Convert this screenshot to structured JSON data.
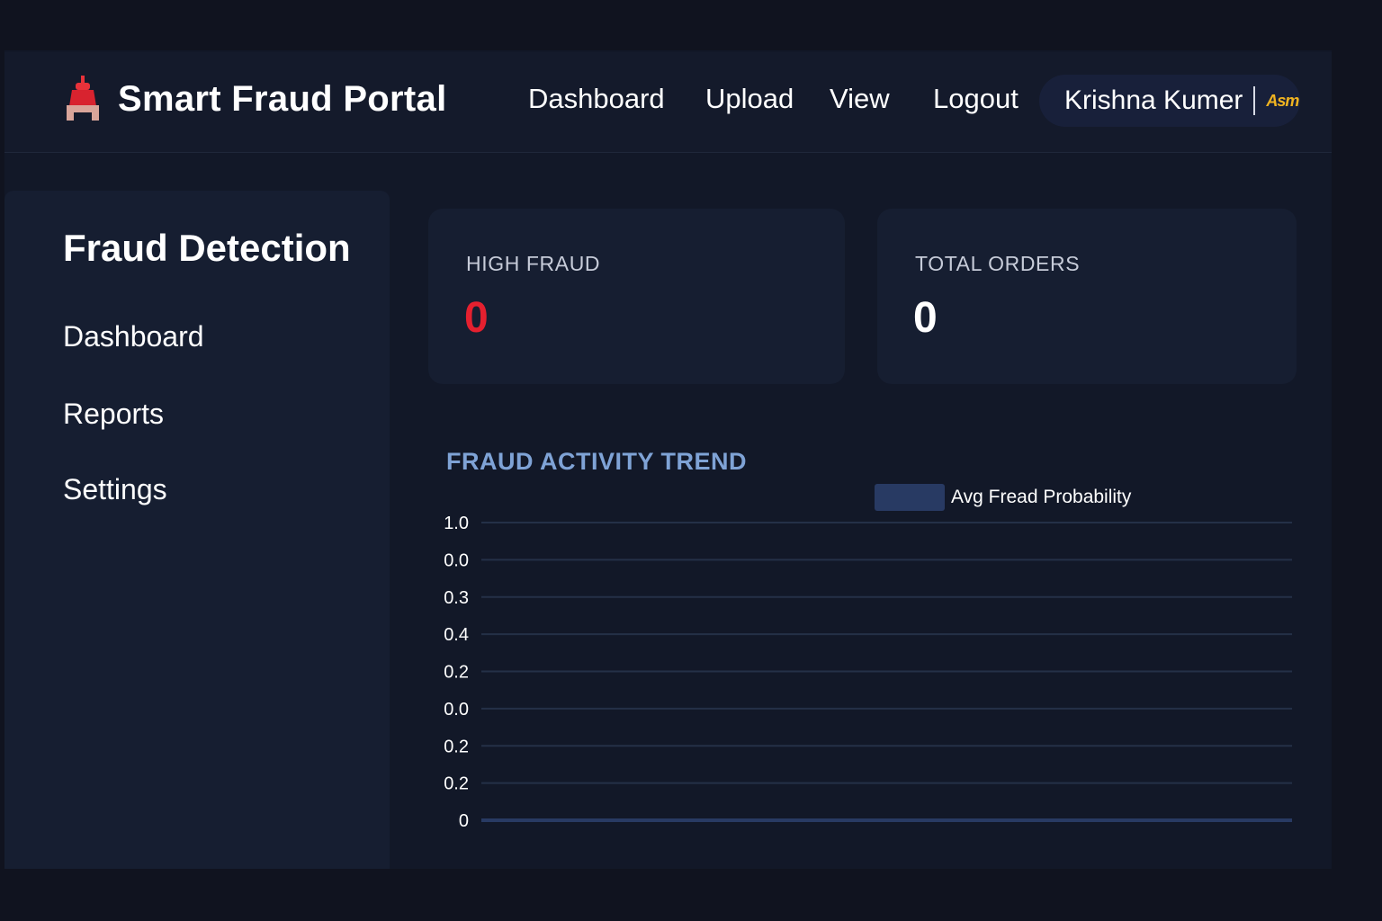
{
  "navbar": {
    "brand_title": "Smart Fraud Portal",
    "links": [
      "Dashboard",
      "Upload",
      "View",
      "Logout"
    ],
    "user_name": "Krishna Kumer",
    "user_badge": "Asm"
  },
  "sidebar": {
    "title": "Fraud Detection",
    "items": [
      "Dashboard",
      "Reports",
      "Settings"
    ]
  },
  "cards": [
    {
      "label": "HIGH FRAUD",
      "value": "0",
      "color": "#e5202f"
    },
    {
      "label": "TOTAL ORDERS",
      "value": "0",
      "color": "#ffffff"
    }
  ],
  "chart": {
    "title": "FRAUD ACTIVITY TREND",
    "legend_label": "Avg Fread Probability"
  },
  "chart_data": {
    "type": "line",
    "title": "FRAUD ACTIVITY TREND",
    "y_tick_labels": [
      "1.0",
      "0.0",
      "0.3",
      "0.4",
      "0.2",
      "0.0",
      "0.2",
      "0.2",
      "0"
    ],
    "series": [
      {
        "name": "Avg Fread Probability",
        "values": [
          0,
          0
        ],
        "color": "#283a63"
      }
    ],
    "grid": true,
    "legend": "top"
  },
  "colors": {
    "background": "#10131f",
    "panel": "#161e31",
    "accent": "#7fa3d6",
    "danger": "#e5202f",
    "badge": "#f1b420"
  }
}
